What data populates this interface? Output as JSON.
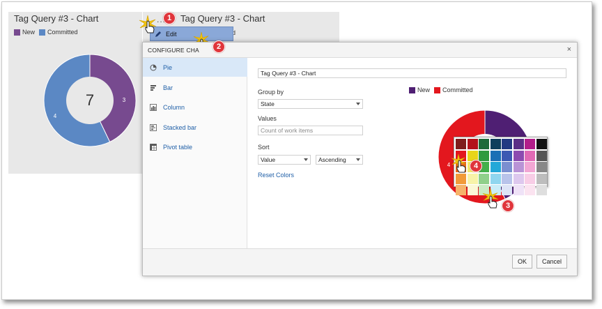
{
  "background": {
    "widget1": {
      "title": "Tag Query #3 - Chart",
      "legend": [
        {
          "label": "New",
          "color": "#774a8f"
        },
        {
          "label": "Committed",
          "color": "#5b88c4"
        }
      ],
      "total": "7",
      "slices": [
        {
          "label": "3",
          "value": 3,
          "color": "#774a8f"
        },
        {
          "label": "4",
          "value": 4,
          "color": "#5b88c4"
        }
      ]
    },
    "widget2": {
      "menu_dots": "...",
      "title": "Tag Query #3 - Chart",
      "legend_fragment": "tted"
    },
    "edit_menu": {
      "label": "Edit"
    }
  },
  "callouts": [
    "1",
    "2",
    "3",
    "4"
  ],
  "dialog": {
    "title": "CONFIGURE CHA",
    "close": "×",
    "chart_types": [
      {
        "label": "Pie",
        "icon": "pie-chart-icon",
        "selected": true
      },
      {
        "label": "Bar",
        "icon": "bar-chart-icon",
        "selected": false
      },
      {
        "label": "Column",
        "icon": "column-chart-icon",
        "selected": false
      },
      {
        "label": "Stacked bar",
        "icon": "stacked-bar-icon",
        "selected": false
      },
      {
        "label": "Pivot table",
        "icon": "pivot-table-icon",
        "selected": false
      }
    ],
    "form": {
      "chart_title_value": "Tag Query #3 - Chart",
      "group_by_label": "Group by",
      "group_by_value": "State",
      "values_label": "Values",
      "values_placeholder": "Count of work items",
      "sort_label": "Sort",
      "sort_field_value": "Value",
      "sort_order_value": "Ascending",
      "reset_colors": "Reset Colors"
    },
    "preview": {
      "legend": [
        {
          "label": "New",
          "color": "#4f1f73"
        },
        {
          "label": "Committed",
          "color": "#e3171e"
        }
      ],
      "slices": [
        {
          "label": "3",
          "value": 3,
          "color": "#4f1f73"
        },
        {
          "label": "4",
          "value": 4,
          "color": "#e3171e"
        }
      ],
      "slice_label_visible": "4"
    },
    "palette": [
      "#7f1d1d",
      "#b3121c",
      "#1f6b3a",
      "#0f3f5c",
      "#233a82",
      "#5b2f86",
      "#b21e8a",
      "#111111",
      "#e3171e",
      "#e8d51a",
      "#2f9a3e",
      "#1a6fb5",
      "#3c59b3",
      "#8c4bb0",
      "#e06ab5",
      "#555555",
      "#e66a1a",
      "#f3e96b",
      "#43b04a",
      "#23a8d8",
      "#7a8fd0",
      "#b993d6",
      "#f2a6d4",
      "#888888",
      "#f19a38",
      "#f7f3a8",
      "#8fd08a",
      "#8fd6ef",
      "#b8c3ea",
      "#ddc8ee",
      "#f8cde6",
      "#bdbdbd",
      "#f6b36a",
      "#fbf8d6",
      "#c9ebc4",
      "#c9edf8",
      "#dde3f6",
      "#efe2f7",
      "#fbe3f0",
      "#dedede"
    ],
    "ok_label": "OK",
    "cancel_label": "Cancel"
  }
}
